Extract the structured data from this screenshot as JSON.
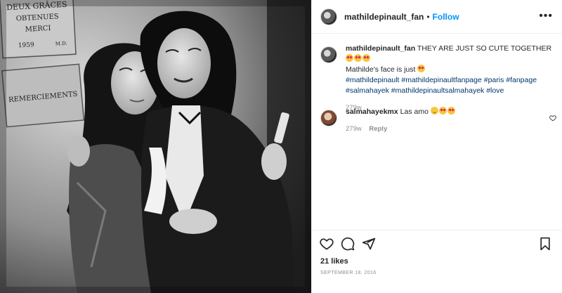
{
  "post": {
    "author": "mathildepinault_fan",
    "dot": "•",
    "follow_label": "Follow",
    "more_icon": "more-icon"
  },
  "photo": {
    "sign_top": [
      "DEUX GRÂCES",
      "OBTENUES",
      "MERCI",
      "1959",
      "M.D."
    ],
    "sign_bottom": "REMERCIEMENTS"
  },
  "caption": {
    "username": "mathildepinault_fan",
    "text_1": "THEY ARE JUST SO CUTE TOGETHER",
    "text_2": "Mathilde's face is just",
    "hashtags_1": "#mathildepinault #mathildepinaultfanpage #paris #fanpage",
    "hashtags_2": "#salmahayek #mathildepinaultsalmahayek #love",
    "time": "279w"
  },
  "comment": {
    "username": "salmahayekmx",
    "text": "Las amo",
    "time": "279w",
    "reply_label": "Reply"
  },
  "likes": "21 likes",
  "date": "September 18, 2016",
  "colors": {
    "link": "#0095f6",
    "hashtag": "#00376b",
    "muted": "#8e8e8e"
  }
}
